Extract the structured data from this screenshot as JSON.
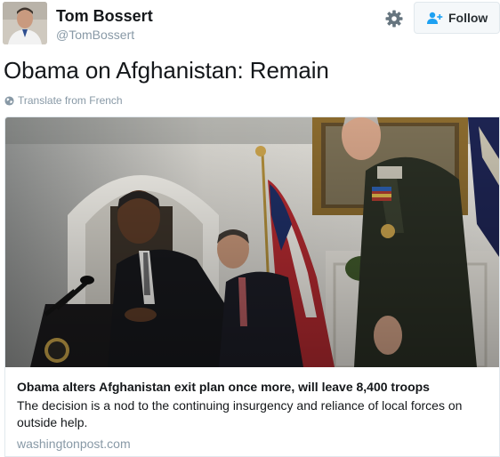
{
  "user": {
    "name": "Tom Bossert",
    "handle": "@TomBossert",
    "avatar_icon": "profile-photo"
  },
  "actions": {
    "settings_icon": "gear-icon",
    "follow_label": "Follow",
    "follow_icon": "add-user-icon"
  },
  "tweet": {
    "text": "Obama on Afghanistan: Remain",
    "translate_label": "Translate from French",
    "translate_icon": "globe-icon"
  },
  "card": {
    "image_alt": "photo",
    "title": "Obama alters Afghanistan exit plan once more, will leave 8,400 troops",
    "description": "The decision is a nod to the continuing insurgency and reliance of local forces on outside help.",
    "domain": "washingtonpost.com"
  },
  "colors": {
    "text": "#14171a",
    "secondary": "#8899a6",
    "follow_blue": "#1da1f2",
    "border": "#e1e8ed"
  }
}
